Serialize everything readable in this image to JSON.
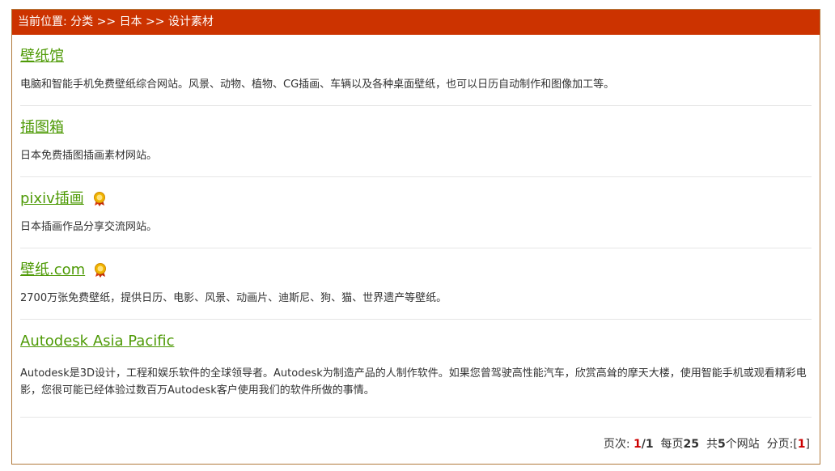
{
  "breadcrumb": {
    "prefix": "当前位置:",
    "items": [
      "分类",
      "日本",
      "设计素材"
    ],
    "separator": ">>"
  },
  "entries": [
    {
      "title": "壁纸馆",
      "badge": false,
      "description": "电脑和智能手机免费壁纸综合网站。风景、动物、植物、CG插画、车辆以及各种桌面壁纸，也可以日历自动制作和图像加工等。"
    },
    {
      "title": "插图箱",
      "badge": false,
      "description": "日本免费插图插画素材网站。"
    },
    {
      "title": "pixiv插画",
      "badge": true,
      "description": "日本插画作品分享交流网站。"
    },
    {
      "title": "壁纸.com",
      "badge": true,
      "description": "2700万张免费壁纸，提供日历、电影、风景、动画片、迪斯尼、狗、猫、世界遗产等壁纸。"
    },
    {
      "title": "Autodesk Asia Pacific",
      "badge": false,
      "description": "Autodesk是3D设计，工程和娱乐软件的全球领导者。Autodesk为制造产品的人制作软件。如果您曾驾驶高性能汽车，欣赏高耸的摩天大楼，使用智能手机或观看精彩电影，您很可能已经体验过数百万Autodesk客户使用我们的软件所做的事情。"
    }
  ],
  "pager": {
    "page_label": "页次:",
    "current_page": "1",
    "total_pages": "/1",
    "per_page_label": "每页",
    "per_page": "25",
    "total_label": "共",
    "total_count": "5",
    "total_suffix": "个网站",
    "pages_label": "分页:",
    "page_link": "1"
  },
  "colors": {
    "header_bg": "#cc3300",
    "link": "#4e9a06",
    "border": "#b07a3c",
    "badge": "#e8a000"
  }
}
